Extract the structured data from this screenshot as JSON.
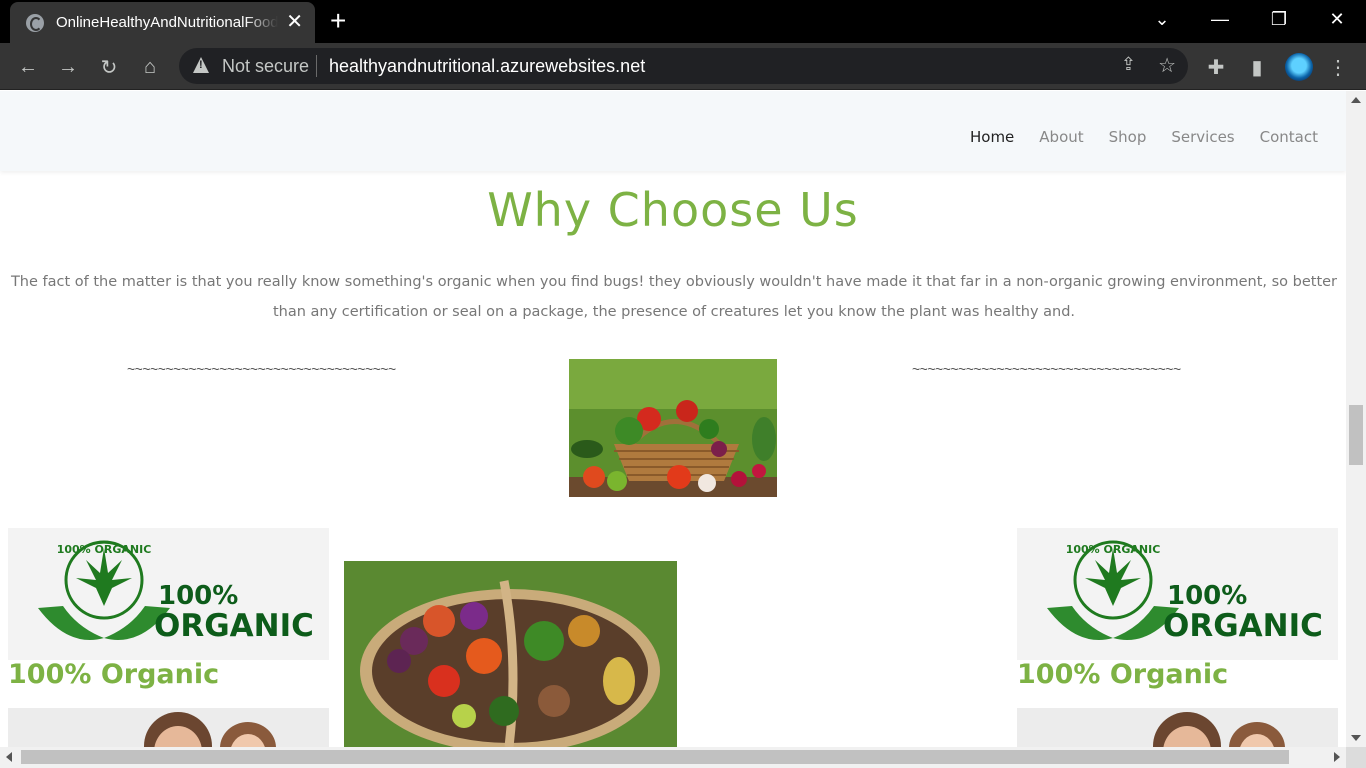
{
  "browser": {
    "tab_title": "OnlineHealthyAndNutritionalFood",
    "tab_close": "✕",
    "new_tab": "+",
    "security_label": "Not secure",
    "url": "healthyandnutritional.azurewebsites.net"
  },
  "nav": {
    "items": [
      "Home",
      "About",
      "Shop",
      "Services",
      "Contact"
    ],
    "active": "Home"
  },
  "section": {
    "heading": "Why Choose Us",
    "paragraph": "The fact of the matter is that you really know something's organic when you find bugs! they obviously wouldn't have made it that far in a non-organic growing environment, so better than any certification or seal on a package, the presence of creatures let you know the plant was healthy and.",
    "tilde_left": "~~~~~~~~~~~~~~~~~~~~~~~~~~~~~~~~~~~",
    "tilde_right": "~~~~~~~~~~~~~~~~~~~~~~~~~~~~~~~~~~~"
  },
  "features": {
    "left_title": "100% Organic",
    "right_title": "100% Organic",
    "logo_top_text": "100% ORGANIC",
    "logo_big_1": "100%",
    "logo_big_2": "ORGANIC"
  },
  "colors": {
    "accent_green": "#7db244",
    "logo_green": "#1f7a1f",
    "nav_bg": "#f5f8fa"
  },
  "scroll": {
    "vertical_fraction": 0.45
  }
}
